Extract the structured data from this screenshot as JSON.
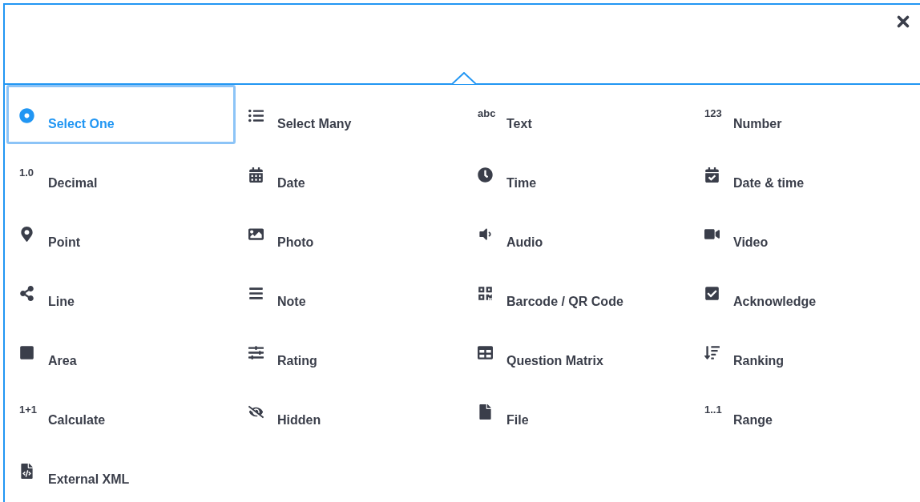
{
  "items": [
    {
      "label": "Select One",
      "kind": "radio",
      "selected": true
    },
    {
      "label": "Select Many",
      "kind": "list",
      "selected": false
    },
    {
      "label": "Text",
      "kind": "glyph",
      "glyph": "abc",
      "selected": false
    },
    {
      "label": "Number",
      "kind": "glyph",
      "glyph": "123",
      "selected": false
    },
    {
      "label": "Decimal",
      "kind": "glyph",
      "glyph": "1.0",
      "selected": false
    },
    {
      "label": "Date",
      "kind": "calendar",
      "selected": false
    },
    {
      "label": "Time",
      "kind": "clock",
      "selected": false
    },
    {
      "label": "Date & time",
      "kind": "datetime",
      "selected": false
    },
    {
      "label": "Point",
      "kind": "pin",
      "selected": false
    },
    {
      "label": "Photo",
      "kind": "image",
      "selected": false
    },
    {
      "label": "Audio",
      "kind": "speaker",
      "selected": false
    },
    {
      "label": "Video",
      "kind": "camera",
      "selected": false
    },
    {
      "label": "Line",
      "kind": "share",
      "selected": false
    },
    {
      "label": "Note",
      "kind": "lines",
      "selected": false
    },
    {
      "label": "Barcode / QR Code",
      "kind": "qr",
      "selected": false
    },
    {
      "label": "Acknowledge",
      "kind": "checkbox",
      "selected": false
    },
    {
      "label": "Area",
      "kind": "square",
      "selected": false
    },
    {
      "label": "Rating",
      "kind": "sliders",
      "selected": false
    },
    {
      "label": "Question Matrix",
      "kind": "table",
      "selected": false
    },
    {
      "label": "Ranking",
      "kind": "sort",
      "selected": false
    },
    {
      "label": "Calculate",
      "kind": "glyph",
      "glyph": "1+1",
      "selected": false
    },
    {
      "label": "Hidden",
      "kind": "eyeslash",
      "selected": false
    },
    {
      "label": "File",
      "kind": "file",
      "selected": false
    },
    {
      "label": "Range",
      "kind": "glyph",
      "glyph": "1..1",
      "selected": false
    },
    {
      "label": "External XML",
      "kind": "filecode",
      "selected": false
    }
  ]
}
